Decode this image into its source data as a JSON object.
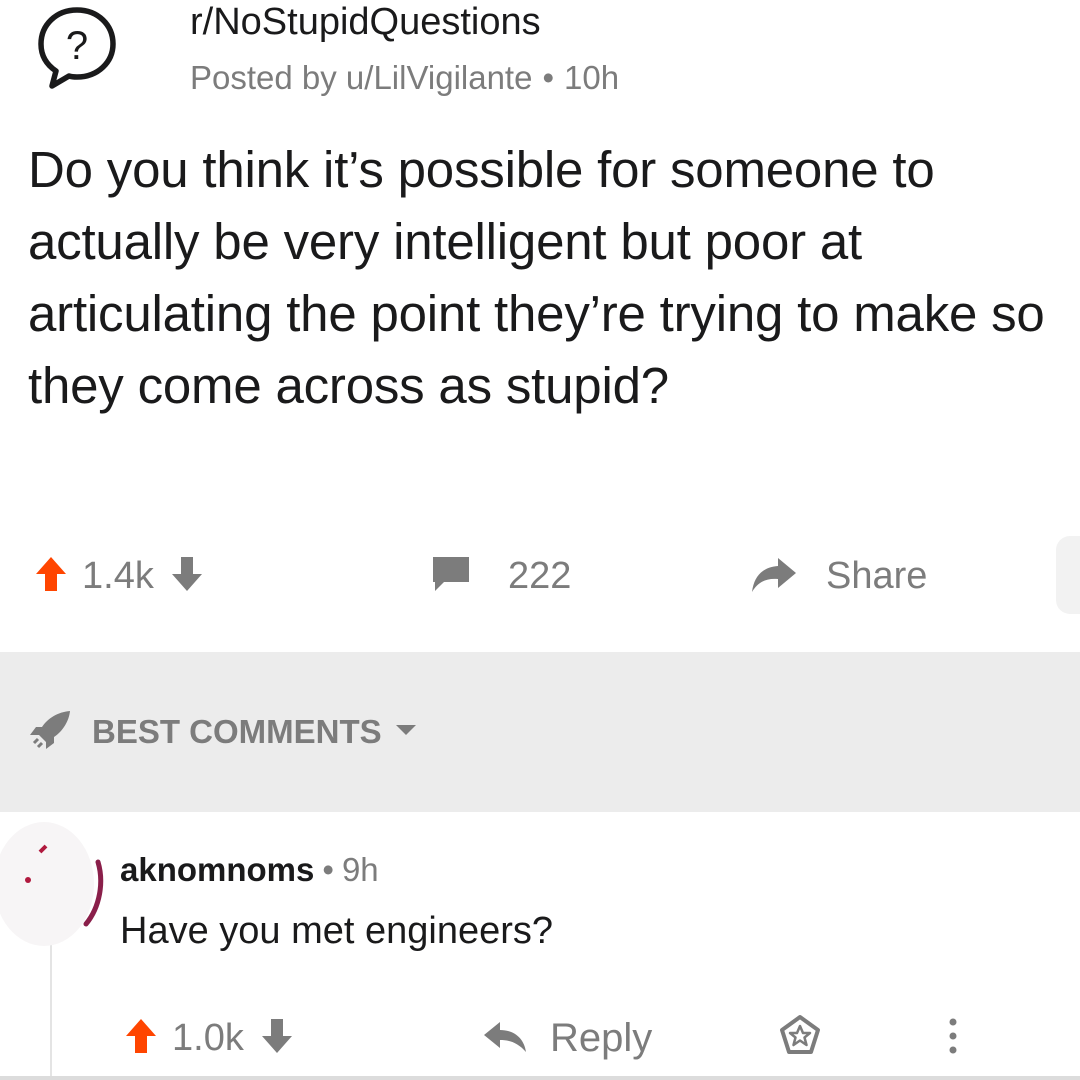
{
  "post": {
    "subreddit": "r/NoStupidQuestions",
    "posted_by": "Posted by u/LilVigilante",
    "age": "10h",
    "title": "Do you think it’s possible for someone to actually be very intelligent but poor at articulating the point they’re trying to make so they come across as stupid?",
    "score": "1.4k",
    "comment_count": "222",
    "share_label": "Share"
  },
  "sort": {
    "label": "BEST COMMENTS"
  },
  "comment": {
    "author": "aknomnoms",
    "age": "9h",
    "body": "Have you met engineers?",
    "score": "1.0k",
    "reply_label": "Reply"
  },
  "colors": {
    "upvote": "#ff4500",
    "muted": "#7c7c7c",
    "sort_bar_bg": "#ececec"
  },
  "icons": {
    "subreddit": "question-mark-bubble-icon",
    "upvote": "arrow-up-icon",
    "downvote": "arrow-down-icon",
    "comments": "speech-bubble-icon",
    "share": "share-arrow-icon",
    "sort": "rocket-icon",
    "reply": "reply-arrow-icon",
    "award": "award-icon",
    "more": "more-vertical-icon"
  }
}
